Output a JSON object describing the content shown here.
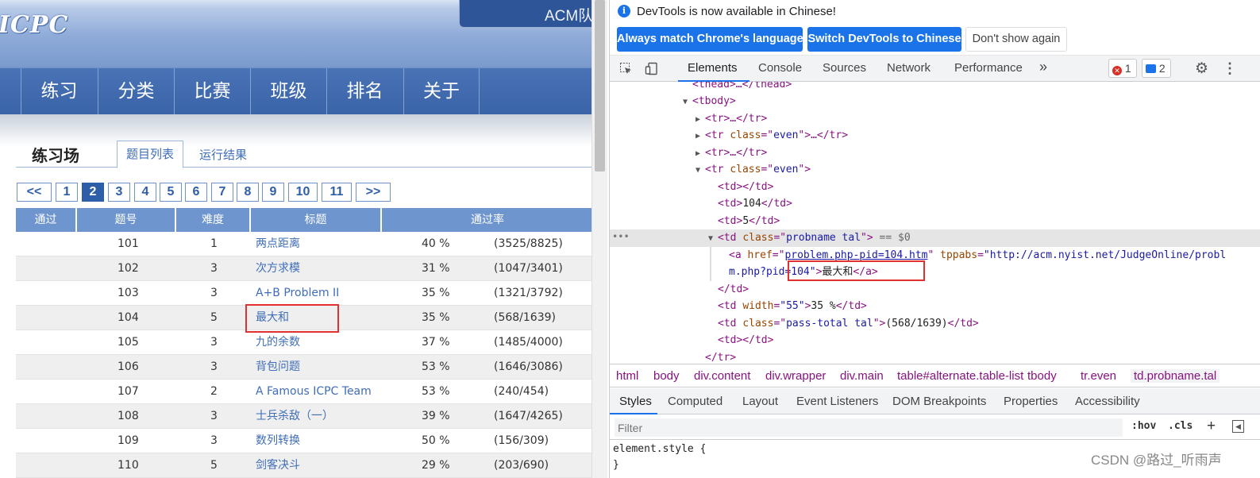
{
  "site": {
    "logo": "ICPC",
    "top_right": "ACM队",
    "nav": [
      "练习",
      "分类",
      "比赛",
      "班级",
      "排名",
      "关于"
    ],
    "page_title": "练习场",
    "tabs": [
      "题目列表",
      "运行结果"
    ]
  },
  "pagination": [
    "<<",
    "1",
    "2",
    "3",
    "4",
    "5",
    "6",
    "7",
    "8",
    "9",
    "10",
    "11",
    ">>"
  ],
  "pagination_current": "2",
  "table": {
    "headers": [
      "通过",
      "题号",
      "难度",
      "标题",
      "通过率"
    ],
    "rows": [
      {
        "id": "101",
        "diff": "1",
        "title": "两点距离",
        "rate": "40 %",
        "ratio": "(3525/8825)"
      },
      {
        "id": "102",
        "diff": "3",
        "title": "次方求模",
        "rate": "31 %",
        "ratio": "(1047/3401)"
      },
      {
        "id": "103",
        "diff": "3",
        "title": "A+B Problem II",
        "rate": "35 %",
        "ratio": "(1321/3792)"
      },
      {
        "id": "104",
        "diff": "5",
        "title": "最大和",
        "rate": "35 %",
        "ratio": "(568/1639)"
      },
      {
        "id": "105",
        "diff": "3",
        "title": "九的余数",
        "rate": "37 %",
        "ratio": "(1485/4000)"
      },
      {
        "id": "106",
        "diff": "3",
        "title": "背包问题",
        "rate": "53 %",
        "ratio": "(1646/3086)"
      },
      {
        "id": "107",
        "diff": "2",
        "title": "A Famous ICPC Team",
        "rate": "53 %",
        "ratio": "(240/454)"
      },
      {
        "id": "108",
        "diff": "3",
        "title": "士兵杀敌（一）",
        "rate": "39 %",
        "ratio": "(1647/4265)"
      },
      {
        "id": "109",
        "diff": "3",
        "title": "数列转换",
        "rate": "50 %",
        "ratio": "(156/309)"
      },
      {
        "id": "110",
        "diff": "5",
        "title": "剑客决斗",
        "rate": "29 %",
        "ratio": "(203/690)"
      }
    ]
  },
  "devtools": {
    "info": "DevTools is now available in Chinese!",
    "btn_match": "Always match Chrome's language",
    "btn_switch": "Switch DevTools to Chinese",
    "btn_dismiss": "Don't show again",
    "tabs": [
      "Elements",
      "Console",
      "Sources",
      "Network",
      "Performance",
      "»"
    ],
    "errors": "1",
    "messages": "2",
    "tree": {
      "l0a": "<",
      "l0b": "thead",
      "l0c": ">…</",
      "l0d": "thead",
      "l0e": ">",
      "l1": "tbody",
      "l2": "tr",
      "l3_class": "even",
      "l4": "tr",
      "l5_class": "even",
      "l6": "td",
      "l7": "104",
      "l8": "5",
      "l9_class": "probname tal",
      "l9_tail": " == $0",
      "l10_href": "problem.php-pid=104.htm",
      "l10_attr": "tppabs",
      "l10_val": "\"http://acm.nyist.net/JudgeOnline/probl",
      "l11_val": "m.php?pid=104\"",
      "l11_text": "最大和",
      "l13_width": "\"55\"",
      "l13_text": "35 %",
      "l14_class": "pass-total tal",
      "l14_text": "(568/1639)",
      "ellipsis": "•••"
    },
    "breadcrumb": [
      "html",
      "body",
      "div.content",
      "div.wrapper",
      "div.main",
      "table#alternate.table-list",
      "tbody",
      "tr.even",
      "td.probname.tal"
    ],
    "styles_tabs": [
      "Styles",
      "Computed",
      "Layout",
      "Event Listeners",
      "DOM Breakpoints",
      "Properties",
      "Accessibility"
    ],
    "filter_placeholder": "Filter",
    "hov": ":hov",
    "cls": ".cls",
    "element_style": "element.style {",
    "close_brace": "}"
  },
  "watermark": "CSDN @路过_听雨声",
  "colors": {
    "nav": "#3a64a8",
    "link": "#3f6db8",
    "highlight": "#e03030",
    "devtools_blue": "#1a73e8"
  }
}
